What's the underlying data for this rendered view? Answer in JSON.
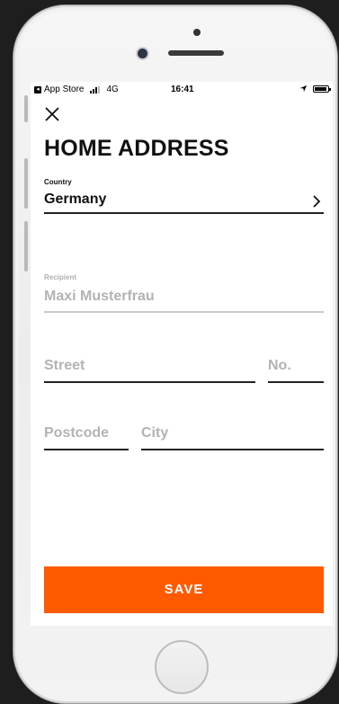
{
  "status_bar": {
    "carrier": "App Store",
    "network": "4G",
    "time": "16:41"
  },
  "screen": {
    "title": "HOME ADDRESS",
    "country": {
      "label": "Country",
      "value": "Germany"
    },
    "recipient": {
      "label": "Recipient",
      "value": "Maxi Musterfrau"
    },
    "street": {
      "placeholder": "Street"
    },
    "number": {
      "placeholder": "No."
    },
    "postcode": {
      "placeholder": "Postcode"
    },
    "city": {
      "placeholder": "City"
    },
    "save_label": "SAVE"
  },
  "colors": {
    "accent": "#ff5a00",
    "text": "#111111",
    "placeholder": "#b3b3b3"
  },
  "icons": [
    "close-icon",
    "chevron-right-icon",
    "location-arrow-icon",
    "battery-icon",
    "signal-icon"
  ]
}
